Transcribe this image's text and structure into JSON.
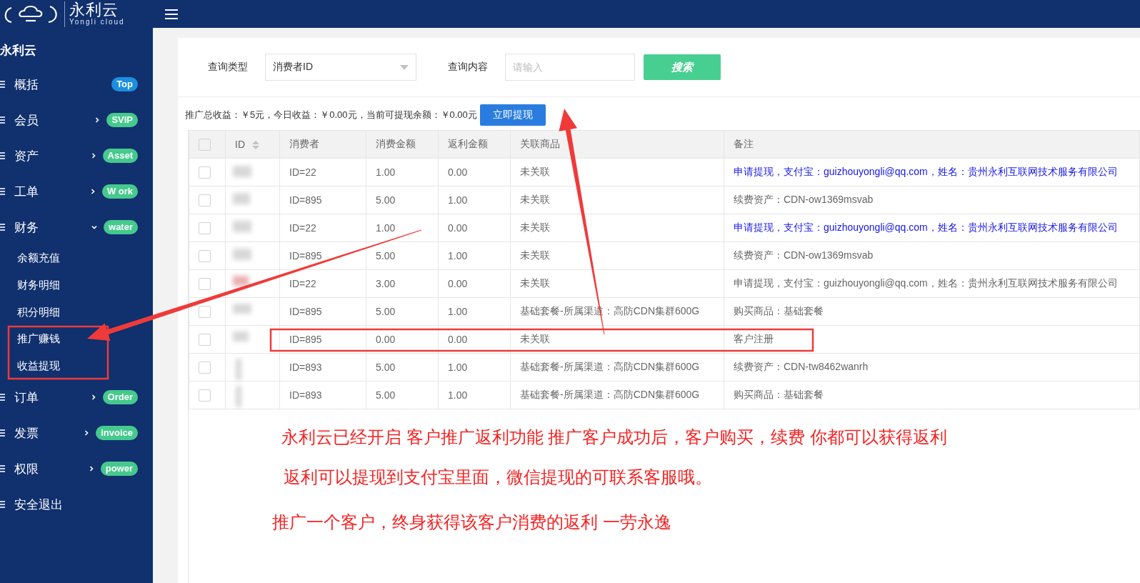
{
  "logo": {
    "title": "永利云",
    "subtitle": "Yongli cloud"
  },
  "sidebar": {
    "title": "永利云",
    "items": [
      {
        "label": "概括",
        "kind": "link",
        "badge": "Top",
        "color": "#1c8fe0"
      },
      {
        "label": "会员",
        "kind": "group",
        "expanded": false,
        "badge": "SVIP",
        "color": "#45c98d"
      },
      {
        "label": "资产",
        "kind": "group",
        "expanded": false,
        "badge": "Asset",
        "color": "#45c98d"
      },
      {
        "label": "工单",
        "kind": "group",
        "expanded": false,
        "badge": "W ork",
        "color": "#45c98d"
      },
      {
        "label": "财务",
        "kind": "group",
        "expanded": true,
        "badge": "water",
        "color": "#45c98d",
        "children": [
          {
            "label": "余额充值"
          },
          {
            "label": "财务明细"
          },
          {
            "label": "积分明细"
          },
          {
            "label": "推广赚钱"
          },
          {
            "label": "收益提现"
          }
        ]
      },
      {
        "label": "订单",
        "kind": "group",
        "expanded": false,
        "badge": "Order",
        "color": "#45c98d"
      },
      {
        "label": "发票",
        "kind": "group",
        "expanded": false,
        "badge": "invoice",
        "color": "#45c98d"
      },
      {
        "label": "权限",
        "kind": "group",
        "expanded": false,
        "badge": "power",
        "color": "#45c98d"
      },
      {
        "label": "安全退出",
        "kind": "link"
      }
    ]
  },
  "search": {
    "type_label": "查询类型",
    "type_value": "消费者ID",
    "content_label": "查询内容",
    "content_placeholder": "请输入",
    "button": "搜索"
  },
  "summary": {
    "text": "推广总收益：￥5元，今日收益：￥0.00元，当前可提现余额：￥0.00元",
    "button": "立即提现"
  },
  "table": {
    "all_checked": false,
    "columns": [
      "ID",
      "消费者",
      "消费金额",
      "返利金额",
      "关联商品",
      "备注"
    ],
    "rows": [
      {
        "checked": false,
        "consumer": "ID=22",
        "amount": "1.00",
        "rebate": "0.00",
        "product": "未关联",
        "note": "申请提现，支付宝：guizhouyongli@qq.com，姓名：贵州永利互联网技术服务有限公司",
        "note_highlighted": true
      },
      {
        "checked": false,
        "consumer": "ID=895",
        "amount": "5.00",
        "rebate": "1.00",
        "product": "未关联",
        "note": "续费资产：CDN-ow1369msvab",
        "note_highlighted": false
      },
      {
        "checked": false,
        "consumer": "ID=22",
        "amount": "1.00",
        "rebate": "0.00",
        "product": "未关联",
        "note": "申请提现，支付宝：guizhouyongli@qq.com，姓名：贵州永利互联网技术服务有限公司",
        "note_highlighted": true
      },
      {
        "checked": false,
        "consumer": "ID=895",
        "amount": "5.00",
        "rebate": "1.00",
        "product": "未关联",
        "note": "续费资产：CDN-ow1369msvab",
        "note_highlighted": false
      },
      {
        "checked": false,
        "consumer": "ID=22",
        "amount": "3.00",
        "rebate": "0.00",
        "product": "未关联",
        "note": "申请提现，支付宝：guizhouyongli@qq.com，姓名：贵州永利互联网技术服务有限公司",
        "note_highlighted": false
      },
      {
        "checked": false,
        "consumer": "ID=895",
        "amount": "5.00",
        "rebate": "1.00",
        "product": "基础套餐-所属渠道：高防CDN集群600G",
        "note": "购买商品：基础套餐",
        "note_highlighted": false
      },
      {
        "checked": false,
        "consumer": "ID=895",
        "amount": "0.00",
        "rebate": "0.00",
        "product": "未关联",
        "note": "客户注册",
        "note_highlighted": false
      },
      {
        "checked": false,
        "consumer": "ID=893",
        "amount": "5.00",
        "rebate": "1.00",
        "product": "基础套餐-所属渠道：高防CDN集群600G",
        "note": "续费资产：CDN-tw8462wanrh",
        "note_highlighted": false
      },
      {
        "checked": false,
        "consumer": "ID=893",
        "amount": "5.00",
        "rebate": "1.00",
        "product": "基础套餐-所属渠道：高防CDN集群600G",
        "note": "购买商品：基础套餐",
        "note_highlighted": false
      }
    ]
  },
  "annotations": [
    "永利云已经开启 客户推广返利功能 推广客户成功后，客户购买，续费 你都可以获得返利",
    "返利可以提现到支付宝里面，微信提现的可联系客服哦。",
    "推广一个客户，终身获得该客户消费的返利 一劳永逸"
  ]
}
